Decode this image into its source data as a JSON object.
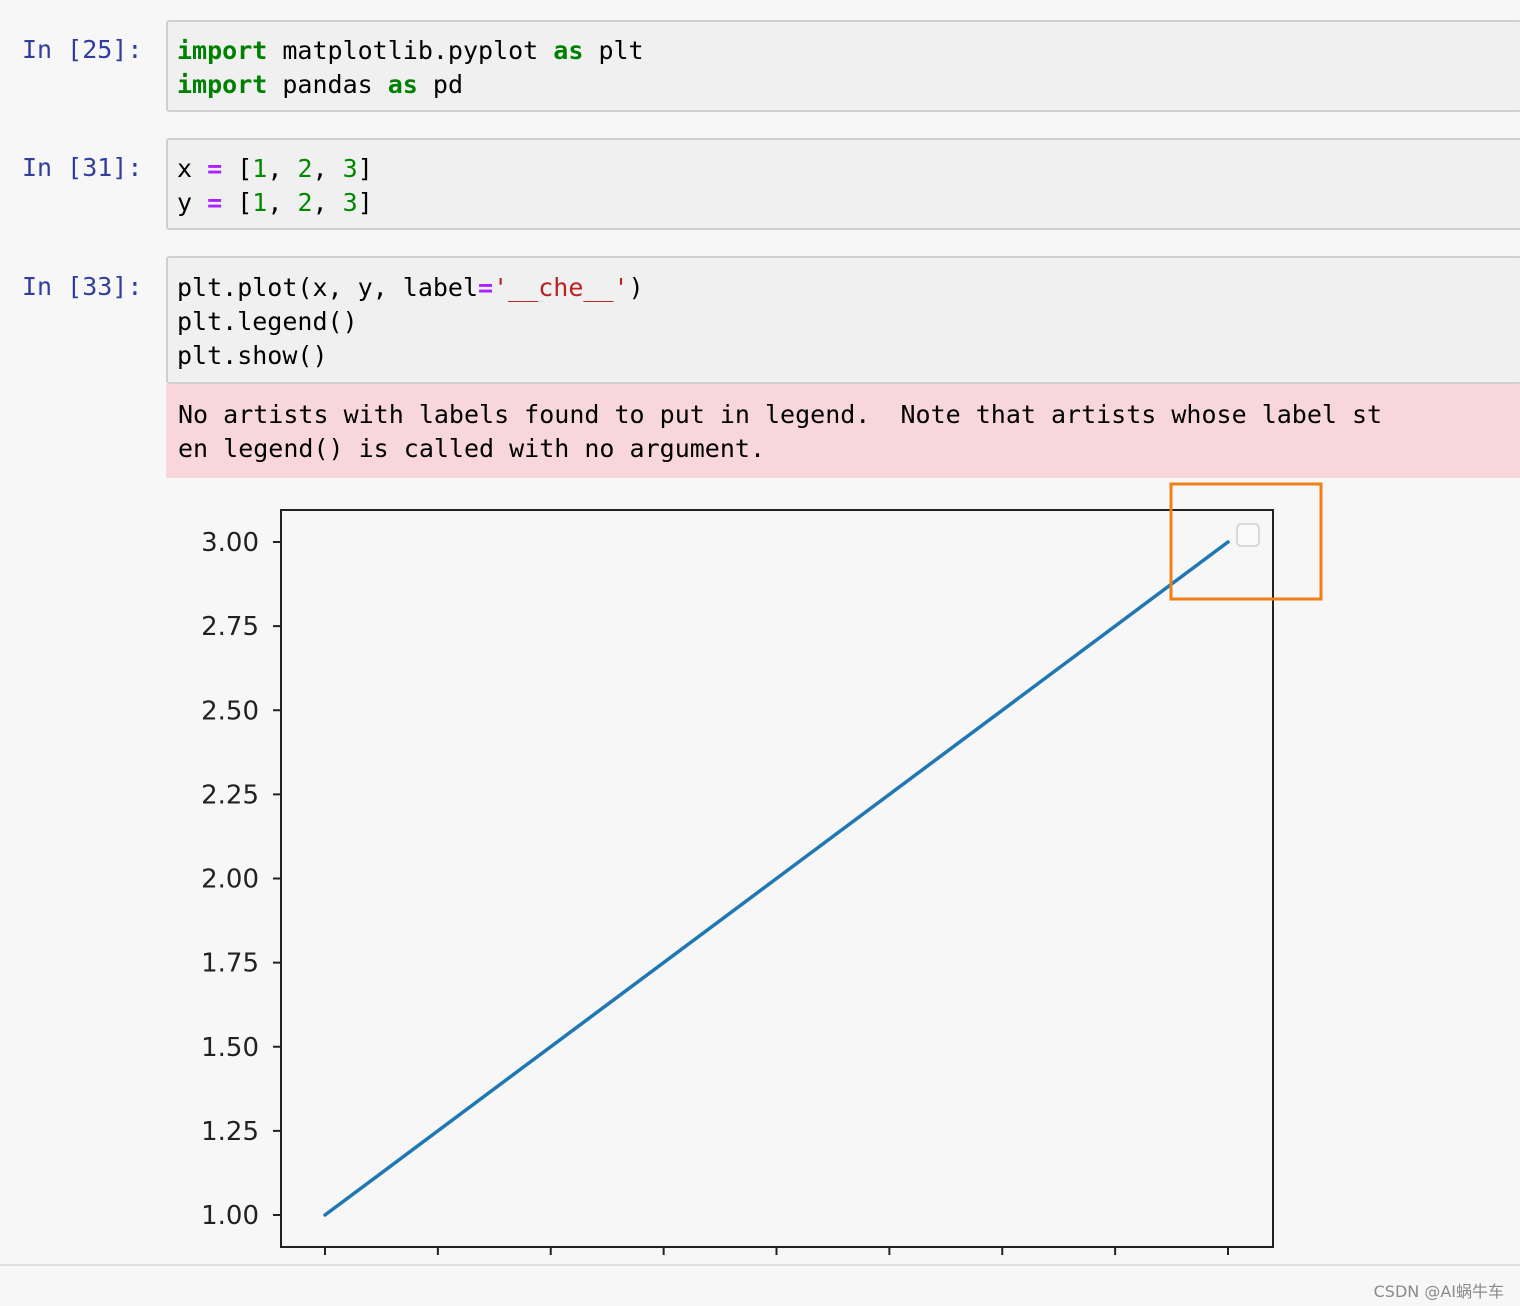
{
  "cells": [
    {
      "prompt": "In [25]:",
      "lines": [
        [
          {
            "t": "import",
            "c": "kw"
          },
          {
            "t": " matplotlib.pyplot ",
            "c": ""
          },
          {
            "t": "as",
            "c": "kw"
          },
          {
            "t": " plt",
            "c": ""
          }
        ],
        [
          {
            "t": "import",
            "c": "kw"
          },
          {
            "t": " pandas ",
            "c": ""
          },
          {
            "t": "as",
            "c": "kw"
          },
          {
            "t": " pd",
            "c": ""
          }
        ]
      ]
    },
    {
      "prompt": "In [31]:",
      "lines": [
        [
          {
            "t": "x ",
            "c": ""
          },
          {
            "t": "=",
            "c": "op"
          },
          {
            "t": " [",
            "c": ""
          },
          {
            "t": "1",
            "c": "num"
          },
          {
            "t": ", ",
            "c": ""
          },
          {
            "t": "2",
            "c": "num"
          },
          {
            "t": ", ",
            "c": ""
          },
          {
            "t": "3",
            "c": "num"
          },
          {
            "t": "]",
            "c": ""
          }
        ],
        [
          {
            "t": "y ",
            "c": ""
          },
          {
            "t": "=",
            "c": "op"
          },
          {
            "t": " [",
            "c": ""
          },
          {
            "t": "1",
            "c": "num"
          },
          {
            "t": ", ",
            "c": ""
          },
          {
            "t": "2",
            "c": "num"
          },
          {
            "t": ", ",
            "c": ""
          },
          {
            "t": "3",
            "c": "num"
          },
          {
            "t": "]",
            "c": ""
          }
        ]
      ]
    },
    {
      "prompt": "In [33]:",
      "lines": [
        [
          {
            "t": "plt.plot(x, y, label",
            "c": ""
          },
          {
            "t": "=",
            "c": "op"
          },
          {
            "t": "'__che__'",
            "c": "str"
          },
          {
            "t": ")",
            "c": ""
          }
        ],
        [
          {
            "t": "plt.legend()",
            "c": ""
          }
        ],
        [
          {
            "t": "plt.show()",
            "c": ""
          }
        ]
      ]
    }
  ],
  "stderr": {
    "line1": "No artists with labels found to put in legend.  Note that artists whose label st",
    "line2": "en legend() is called with no argument."
  },
  "chart_data": {
    "type": "line",
    "x": [
      1,
      2,
      3
    ],
    "series": [
      {
        "values": [
          1,
          2,
          3
        ],
        "color": "#1f77b4"
      }
    ],
    "ylim": [
      1.0,
      3.0
    ],
    "yticks": [
      "1.00",
      "1.25",
      "1.50",
      "1.75",
      "2.00",
      "2.25",
      "2.50",
      "2.75",
      "3.00"
    ],
    "xticks": [
      1.0,
      1.25,
      1.5,
      1.75,
      2.0,
      2.25,
      2.5,
      2.75,
      3.0
    ],
    "xtick_labels_visible": false,
    "legend": "top-right (empty)",
    "highlight_color": "#f07f16"
  },
  "watermark": "CSDN @AI蜗牛车"
}
